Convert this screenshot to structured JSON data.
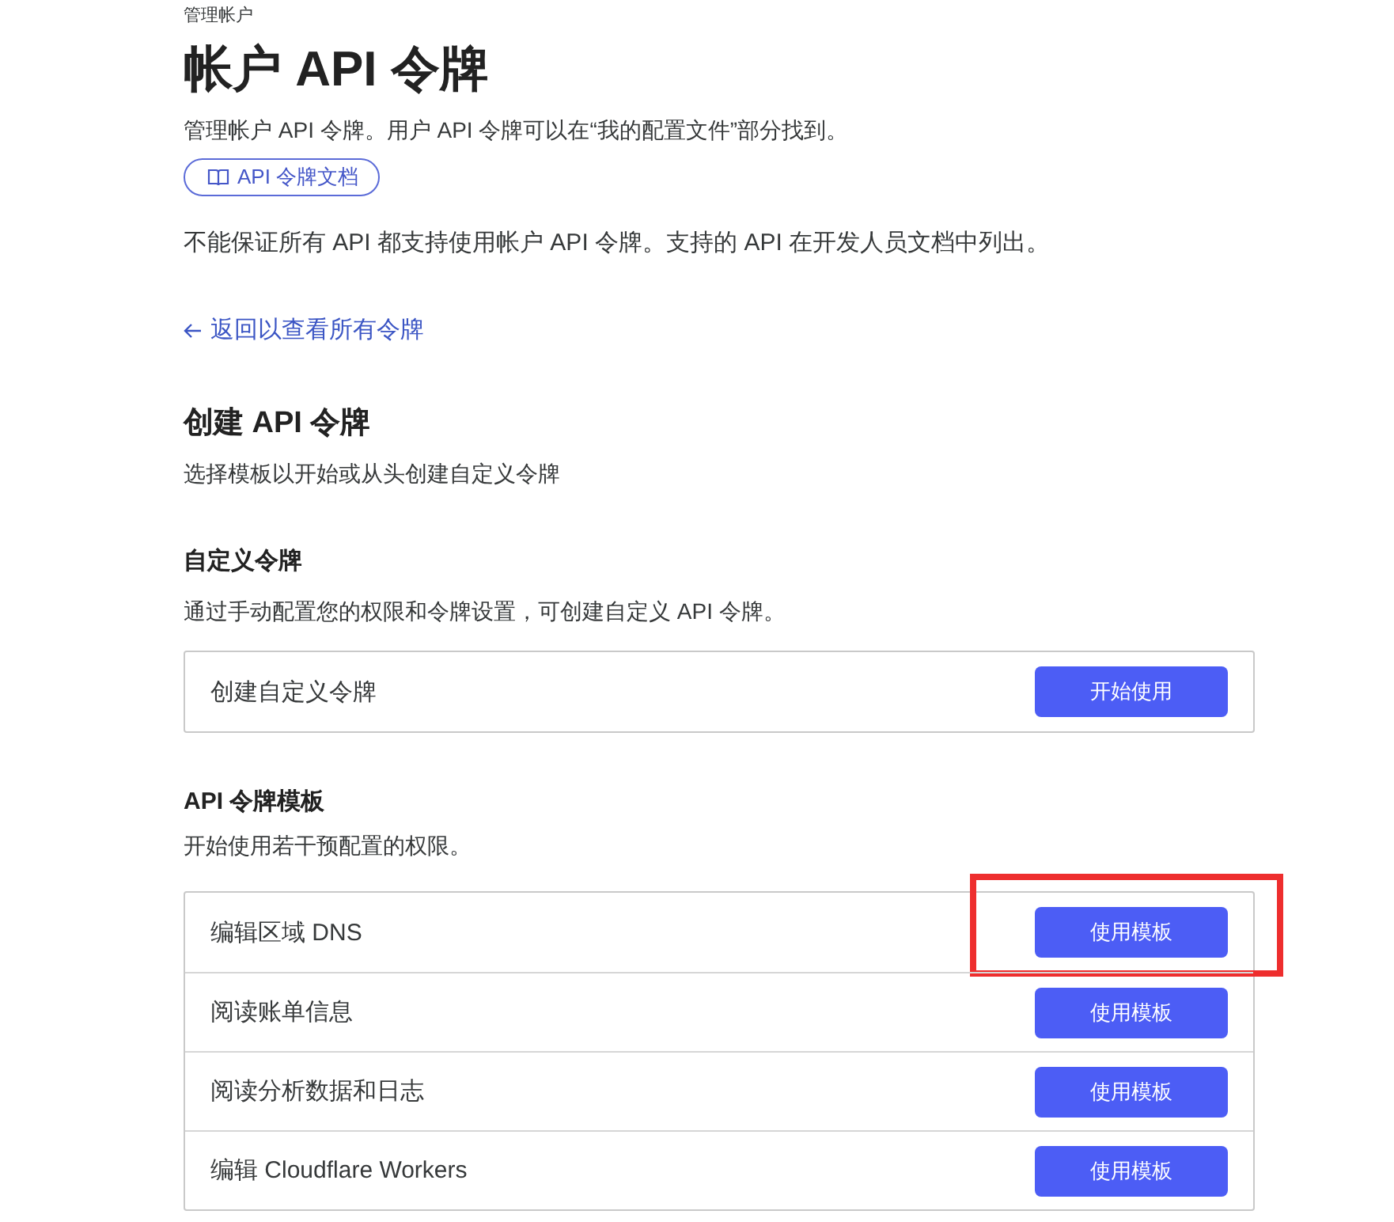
{
  "breadcrumb": "管理帐户",
  "title": "帐户 API 令牌",
  "description": "管理帐户 API 令牌。用户 API 令牌可以在“我的配置文件”部分找到。",
  "docs_link": {
    "label": "API 令牌文档"
  },
  "notice": "不能保证所有 API 都支持使用帐户 API 令牌。支持的 API 在开发人员文档中列出。",
  "back_link": {
    "label": "返回以查看所有令牌"
  },
  "create_section": {
    "title": "创建 API 令牌",
    "subtitle": "选择模板以开始或从头创建自定义令牌"
  },
  "custom_token": {
    "title": "自定义令牌",
    "description": "通过手动配置您的权限和令牌设置，可创建自定义 API 令牌。",
    "row": {
      "name": "创建自定义令牌",
      "button": "开始使用"
    }
  },
  "templates": {
    "title": "API 令牌模板",
    "description": "开始使用若干预配置的权限。",
    "items": [
      {
        "name": "编辑区域 DNS",
        "button": "使用模板",
        "highlighted": true
      },
      {
        "name": "阅读账单信息",
        "button": "使用模板",
        "highlighted": false
      },
      {
        "name": "阅读分析数据和日志",
        "button": "使用模板",
        "highlighted": false
      },
      {
        "name": "编辑 Cloudflare Workers",
        "button": "使用模板",
        "highlighted": false
      }
    ]
  }
}
